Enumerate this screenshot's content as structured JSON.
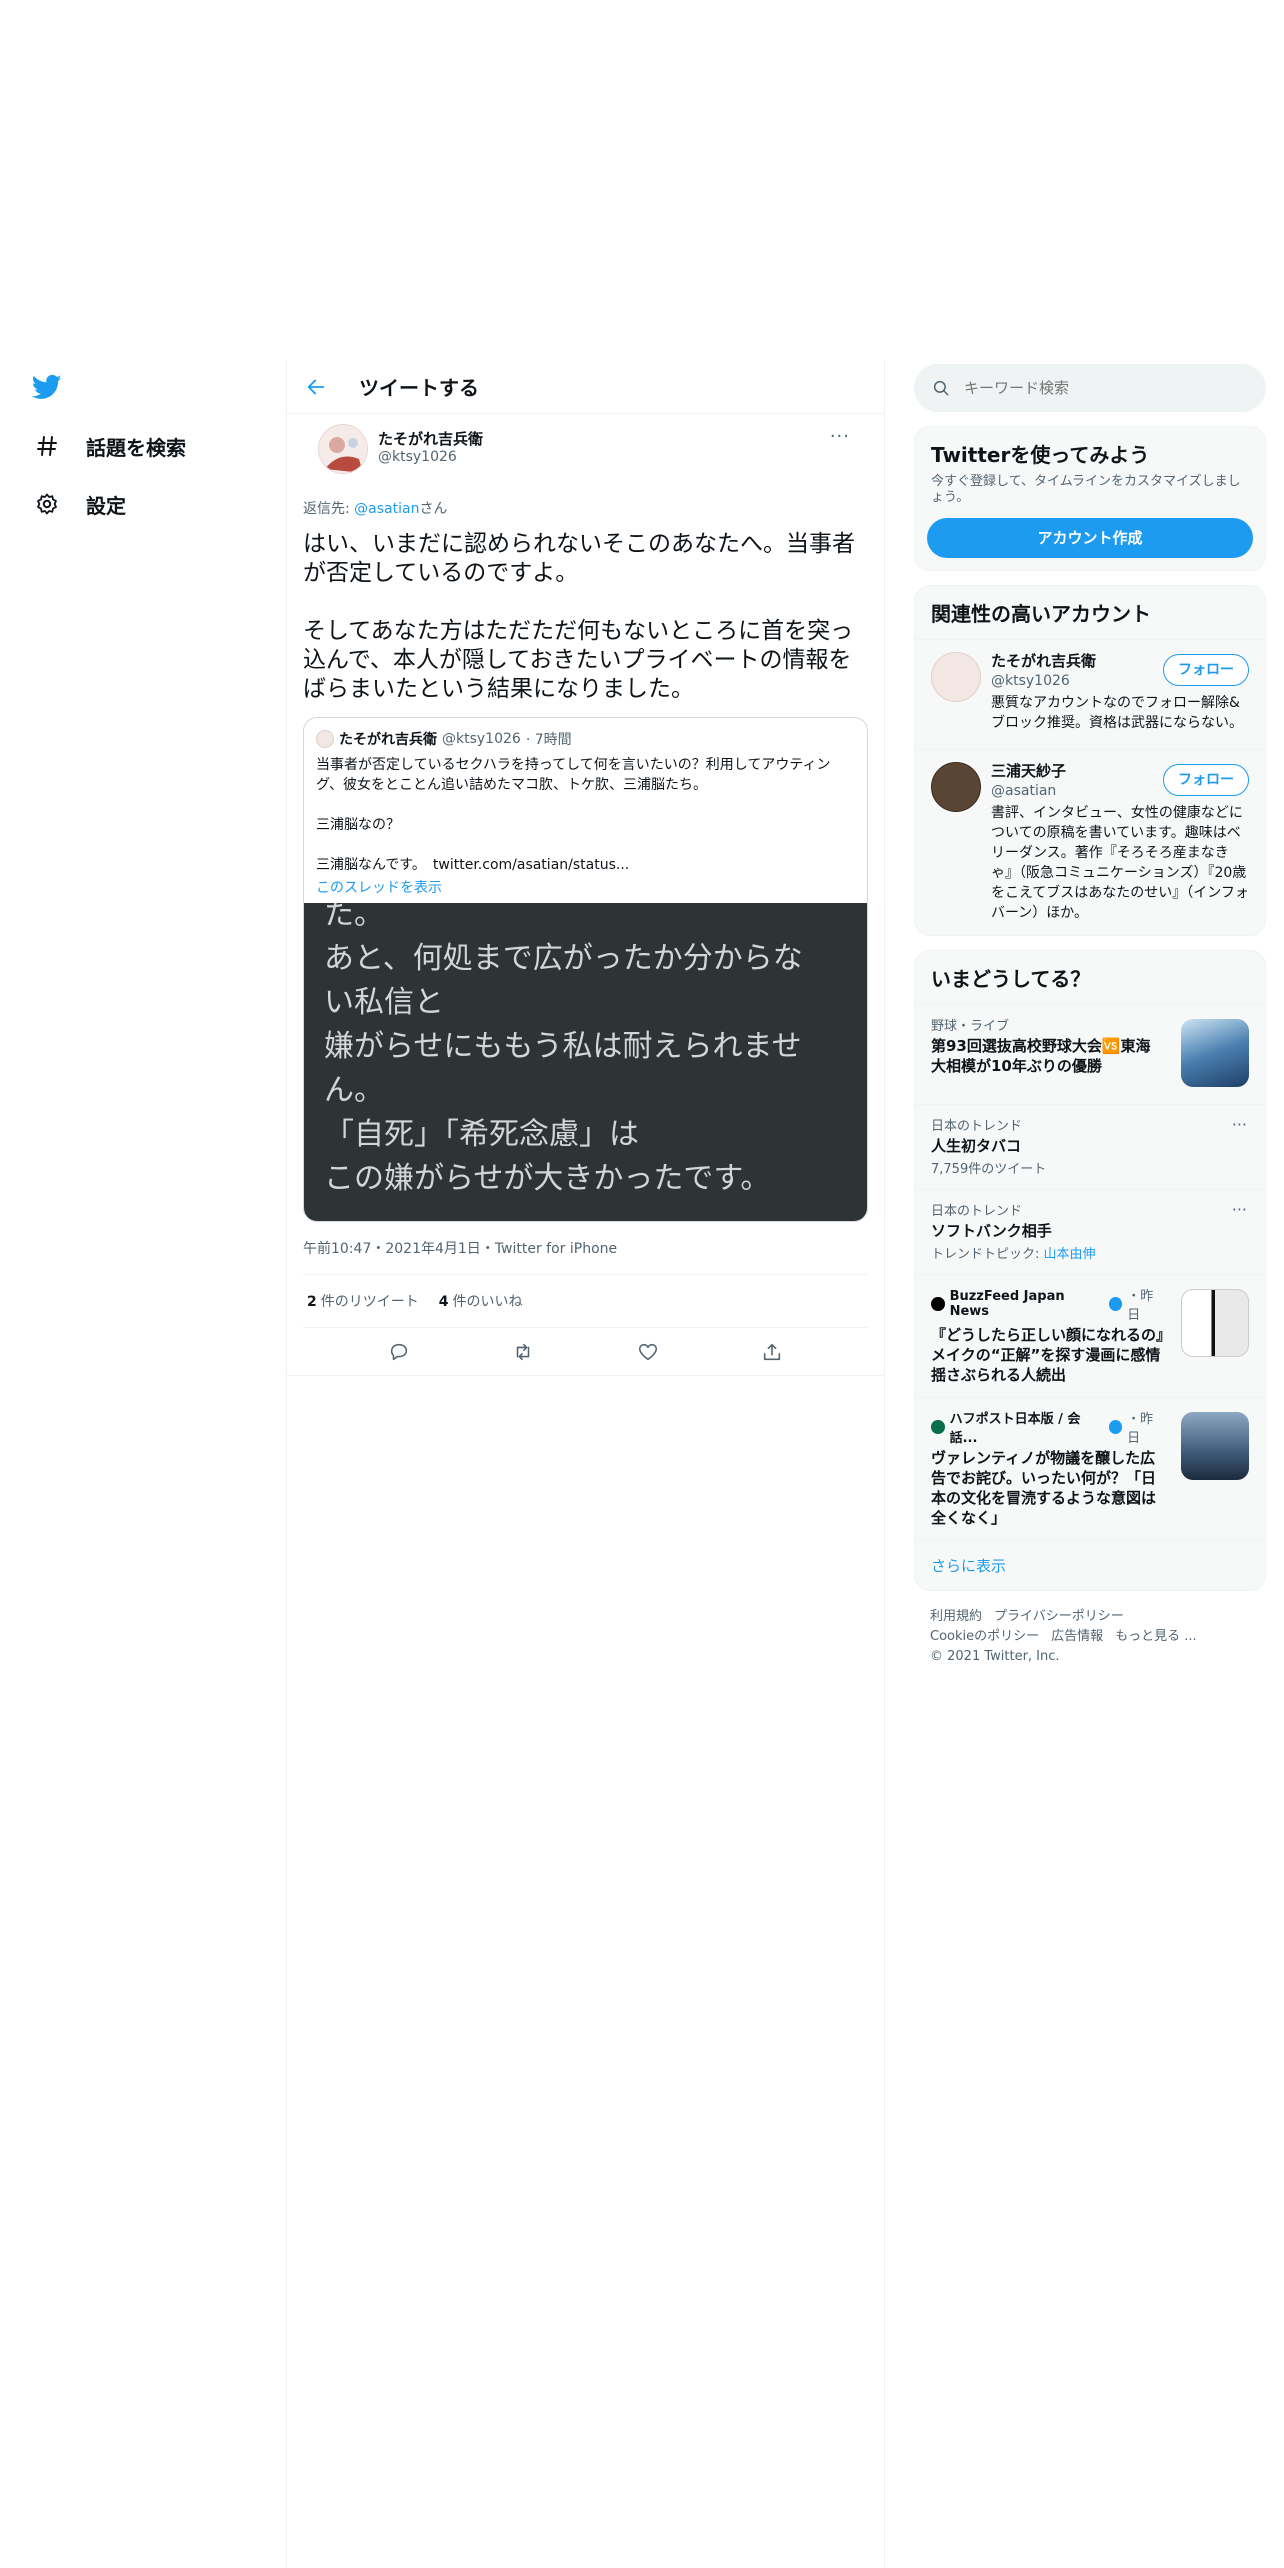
{
  "nav": {
    "explore_label": "話題を検索",
    "settings_label": "設定"
  },
  "header": {
    "title": "ツイートする"
  },
  "tweet": {
    "author_name": "たそがれ吉兵衛",
    "author_handle": "@ktsy1026",
    "more_label": "···",
    "reply_prefix": "返信先: ",
    "reply_mention": "@asatian",
    "reply_suffix": "さん",
    "body_p1": "はい、いまだに認められないそこのあなたへ。当事者が否定しているのですよ。",
    "body_p2": "そしてあなた方はただただ何もないところに首を突っ込んで、本人が隠しておきたいプライベートの情報をばらまいたという結果になりました。",
    "timestamp": "午前10:47・2021年4月1日・Twitter for iPhone",
    "retweet_count": "2",
    "retweet_label": "件のリツイート",
    "like_count": "4",
    "like_label": "件のいいね"
  },
  "quote": {
    "author_name": "たそがれ吉兵衛",
    "author_handle": "@ktsy1026",
    "time": "· 7時間",
    "p1": "当事者が否定しているセクハラを持ってして何を言いたいの？利用してアウティング、彼女をとことん追い詰めたマコ肷、トケ肷、三浦脳たち。",
    "p2": "三浦脳なの？",
    "p3": "三浦脳なんです。　twitter.com/asatian/status...",
    "thread_link": "このスレッドを表示",
    "image_lines": [
      "た。",
      "あと、何処まで広がったか分からな",
      "い私信と",
      "嫌がらせにももう私は耐えられませ",
      "ん。",
      "「自死」「希死念慮」は",
      "この嫌がらせが大きかったです。"
    ]
  },
  "search": {
    "placeholder": "キーワード検索"
  },
  "signup": {
    "title": "Twitterを使ってみよう",
    "desc": "今すぐ登録して、タイムラインをカスタマイズしましょう。",
    "button": "アカウント作成"
  },
  "related": {
    "title": "関連性の高いアカウント",
    "follow_label": "フォロー",
    "accounts": [
      {
        "name": "たそがれ吉兵衛",
        "handle": "@ktsy1026",
        "bio": "悪質なアカウントなのでフォロー解除&ブロック推奨。資格は武器にならない。"
      },
      {
        "name": "三浦天紗子",
        "handle": "@asatian",
        "bio": "書評、インタビュー、女性の健康などについての原稿を書いています。趣味はベリーダンス。著作『そろそろ産まなきゃ』（阪急コミュニケーションズ）『20歳をこえてブスはあなたのせい』（インフォバーン）ほか。"
      }
    ]
  },
  "trends": {
    "title": "いまどうしてる？",
    "items": [
      {
        "category": "野球・ライブ",
        "title": "第93回選抜高校野球大会🆚東海大相模が10年ぶりの優勝"
      },
      {
        "category": "日本のトレンド",
        "title": "人生初タバコ",
        "count": "7,759件のツイート"
      },
      {
        "category": "日本のトレンド",
        "title": "ソフトバンク相手",
        "topic_prefix": "トレンドトピック: ",
        "topic": "山本由伸"
      },
      {
        "source": "BuzzFeed Japan News",
        "time": "・昨日",
        "title": "『どうしたら正しい顔になれるの』メイクの“正解”を探す漫画に感情揺さぶられる人続出"
      },
      {
        "source": "ハフポスト日本版 / 会話...",
        "time": "・昨日",
        "title": "ヴァレンティノが物議を醸した広告でお詫び。いったい何が？「日本の文化を冒涜するような意図は全くなく」"
      }
    ],
    "show_more": "さらに表示"
  },
  "footer": {
    "links": [
      "利用規約",
      "プライバシーポリシー",
      "Cookieのポリシー",
      "広告情報",
      "もっと見る ..."
    ],
    "copyright": "© 2021 Twitter, Inc."
  },
  "colors": {
    "accent": "#1d9bf0",
    "text": "#0f1419",
    "muted": "#536471",
    "image_bg": "#2e3336"
  },
  "icons": [
    "twitter-logo-icon",
    "hashtag-icon",
    "gear-icon",
    "back-arrow-icon",
    "search-icon",
    "reply-icon",
    "retweet-icon",
    "like-icon",
    "share-icon",
    "verified-icon"
  ]
}
